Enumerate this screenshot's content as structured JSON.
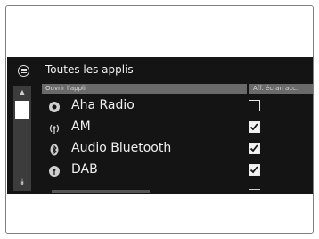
{
  "header": {
    "title": "Toutes les applis",
    "menu_icon": "list-menu-icon"
  },
  "columns": {
    "open_app": "Ouvrir l'appli",
    "show_on_screen": "Aff. écran acc."
  },
  "scrollbar": {
    "up_icon": "scroll-up-icon",
    "down_icon": "scroll-down-icon",
    "down_glyph": "⯯"
  },
  "apps": [
    {
      "label": "Aha Radio",
      "icon": "aha-radio-icon",
      "shown": false
    },
    {
      "label": "AM",
      "icon": "radio-antenna-icon",
      "shown": true
    },
    {
      "label": "Audio Bluetooth",
      "icon": "bluetooth-icon",
      "shown": true
    },
    {
      "label": "DAB",
      "icon": "dab-radio-icon",
      "shown": true
    }
  ],
  "colors": {
    "screen_bg": "#141414",
    "column_header_bg": "#6a6a6a",
    "text": "#f0f0f0"
  }
}
